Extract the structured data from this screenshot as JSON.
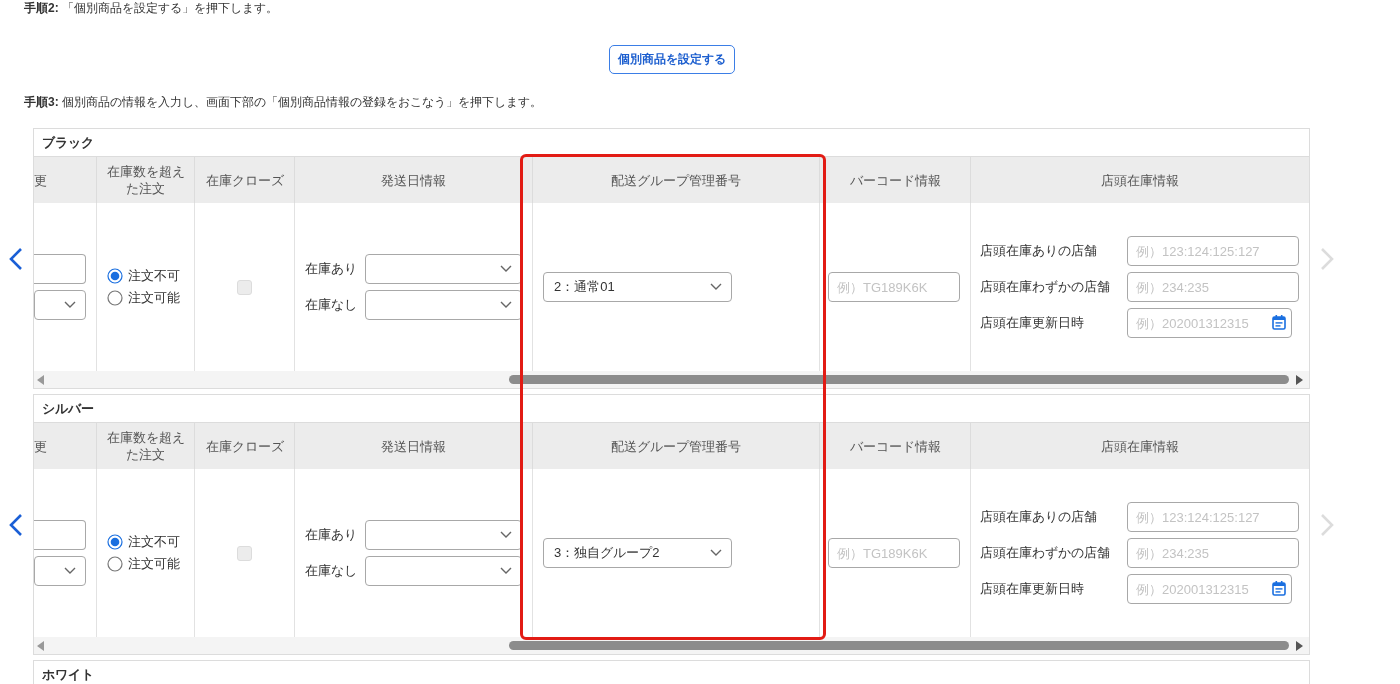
{
  "step_2": "**手順2:** 「個別商品を設定する」を押下します。",
  "set_item_button": {
    "label": "個別商品を設定する"
  },
  "step_3": "**手順3:** 個別商品の情報を入力し、画面下部の「個別商品情報の登録をおこなう」を押下します。",
  "panels": [
    {
      "title": "ブラック",
      "previous_disabled": false,
      "next_disabled": true,
      "columns": [
        {
          "header": "更",
          "kind": "input_select"
        },
        {
          "header": "在庫数を超えた注文",
          "kind": "radio",
          "options": [
            {
              "label": "注文不可",
              "selected": true
            },
            {
              "label": "注文可能",
              "selected": false
            }
          ]
        },
        {
          "header": "在庫クローズ",
          "kind": "checkbox",
          "checked": false,
          "disabled": true
        },
        {
          "header": "発送日情報",
          "kind": "labeled_selects",
          "fields": [
            {
              "label": "在庫あり"
            },
            {
              "label": "在庫なし"
            }
          ]
        },
        {
          "header": "配送グループ管理番号",
          "kind": "select",
          "value": "2：通常01"
        },
        {
          "header": "バーコード情報",
          "kind": "input",
          "placeholder": "例）TG189K6K"
        },
        {
          "header": "店頭在庫情報",
          "kind": "labeled_inputs",
          "fields": [
            {
              "label": "店頭在庫ありの店舗",
              "placeholder": "例）123:124:125:127",
              "kind": "text"
            },
            {
              "label": "店頭在庫わずかの店舗",
              "placeholder": "例）234:235",
              "kind": "text"
            },
            {
              "label": "店頭在庫更新日時",
              "placeholder": "例）202001312315",
              "kind": "date"
            }
          ]
        }
      ]
    },
    {
      "title": "シルバー",
      "previous_disabled": false,
      "next_disabled": true,
      "columns": [
        {
          "header": "更",
          "kind": "input_select"
        },
        {
          "header": "在庫数を超えた注文",
          "kind": "radio",
          "options": [
            {
              "label": "注文不可",
              "selected": true
            },
            {
              "label": "注文可能",
              "selected": false
            }
          ]
        },
        {
          "header": "在庫クローズ",
          "kind": "checkbox",
          "checked": false,
          "disabled": true
        },
        {
          "header": "発送日情報",
          "kind": "labeled_selects",
          "fields": [
            {
              "label": "在庫あり"
            },
            {
              "label": "在庫なし"
            }
          ]
        },
        {
          "header": "配送グループ管理番号",
          "kind": "select",
          "value": "3：独自グループ2"
        },
        {
          "header": "バーコード情報",
          "kind": "input",
          "placeholder": "例）TG189K6K"
        },
        {
          "header": "店頭在庫情報",
          "kind": "labeled_inputs",
          "fields": [
            {
              "label": "店頭在庫ありの店舗",
              "placeholder": "例）123:124:125:127",
              "kind": "text"
            },
            {
              "label": "店頭在庫わずかの店舗",
              "placeholder": "例）234:235",
              "kind": "text"
            },
            {
              "label": "店頭在庫更新日時",
              "placeholder": "例）202001312315",
              "kind": "date"
            }
          ]
        }
      ]
    },
    {
      "title": "ホワイト"
    }
  ]
}
